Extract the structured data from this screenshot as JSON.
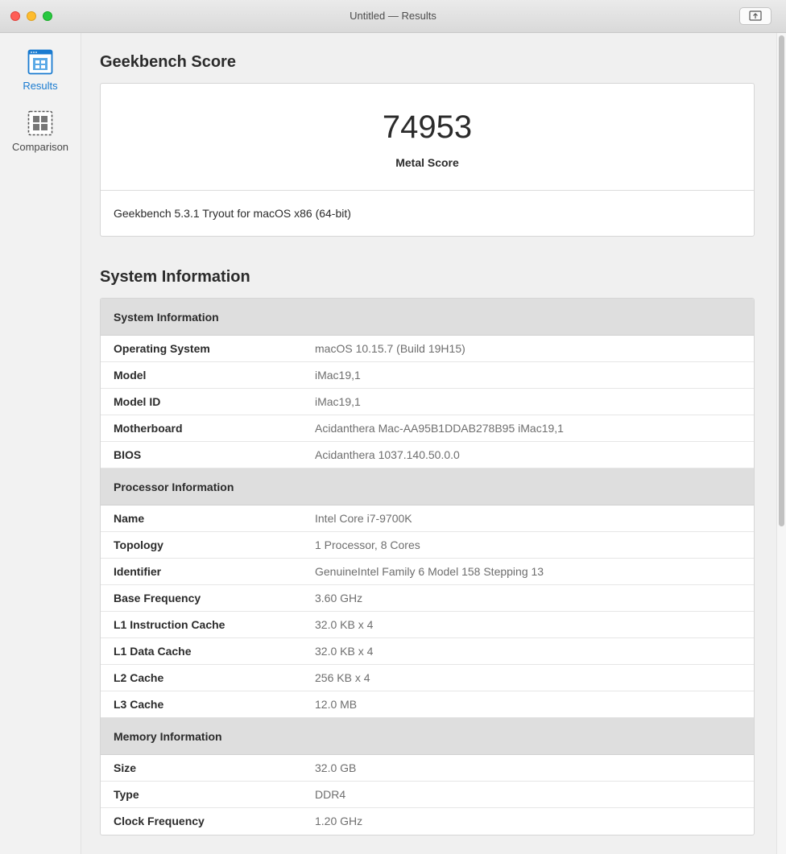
{
  "window": {
    "title": "Untitled — Results"
  },
  "toolbar": {
    "share_icon": "share-icon"
  },
  "sidebar": {
    "items": [
      {
        "label": "Results",
        "icon": "results-icon",
        "selected": true
      },
      {
        "label": "Comparison",
        "icon": "comparison-icon",
        "selected": false
      }
    ]
  },
  "score_section": {
    "title": "Geekbench Score",
    "score": "74953",
    "score_label": "Metal Score",
    "version": "Geekbench 5.3.1 Tryout for macOS x86 (64-bit)"
  },
  "system_section": {
    "title": "System Information",
    "groups": [
      {
        "header": "System Information",
        "rows": [
          {
            "key": "Operating System",
            "value": "macOS 10.15.7 (Build 19H15)"
          },
          {
            "key": "Model",
            "value": "iMac19,1"
          },
          {
            "key": "Model ID",
            "value": "iMac19,1"
          },
          {
            "key": "Motherboard",
            "value": "Acidanthera Mac-AA95B1DDAB278B95 iMac19,1"
          },
          {
            "key": "BIOS",
            "value": "Acidanthera 1037.140.50.0.0"
          }
        ]
      },
      {
        "header": "Processor Information",
        "rows": [
          {
            "key": "Name",
            "value": "Intel Core i7-9700K"
          },
          {
            "key": "Topology",
            "value": "1 Processor, 8 Cores"
          },
          {
            "key": "Identifier",
            "value": "GenuineIntel Family 6 Model 158 Stepping 13"
          },
          {
            "key": "Base Frequency",
            "value": "3.60 GHz"
          },
          {
            "key": "L1 Instruction Cache",
            "value": "32.0 KB x 4"
          },
          {
            "key": "L1 Data Cache",
            "value": "32.0 KB x 4"
          },
          {
            "key": "L2 Cache",
            "value": "256 KB x 4"
          },
          {
            "key": "L3 Cache",
            "value": "12.0 MB"
          }
        ]
      },
      {
        "header": "Memory Information",
        "rows": [
          {
            "key": "Size",
            "value": "32.0 GB"
          },
          {
            "key": "Type",
            "value": "DDR4"
          },
          {
            "key": "Clock Frequency",
            "value": "1.20 GHz"
          }
        ]
      }
    ]
  },
  "colors": {
    "accent": "#1a7bd0",
    "close": "#fe5f57",
    "minimize": "#febc2e",
    "zoom": "#28c840"
  }
}
